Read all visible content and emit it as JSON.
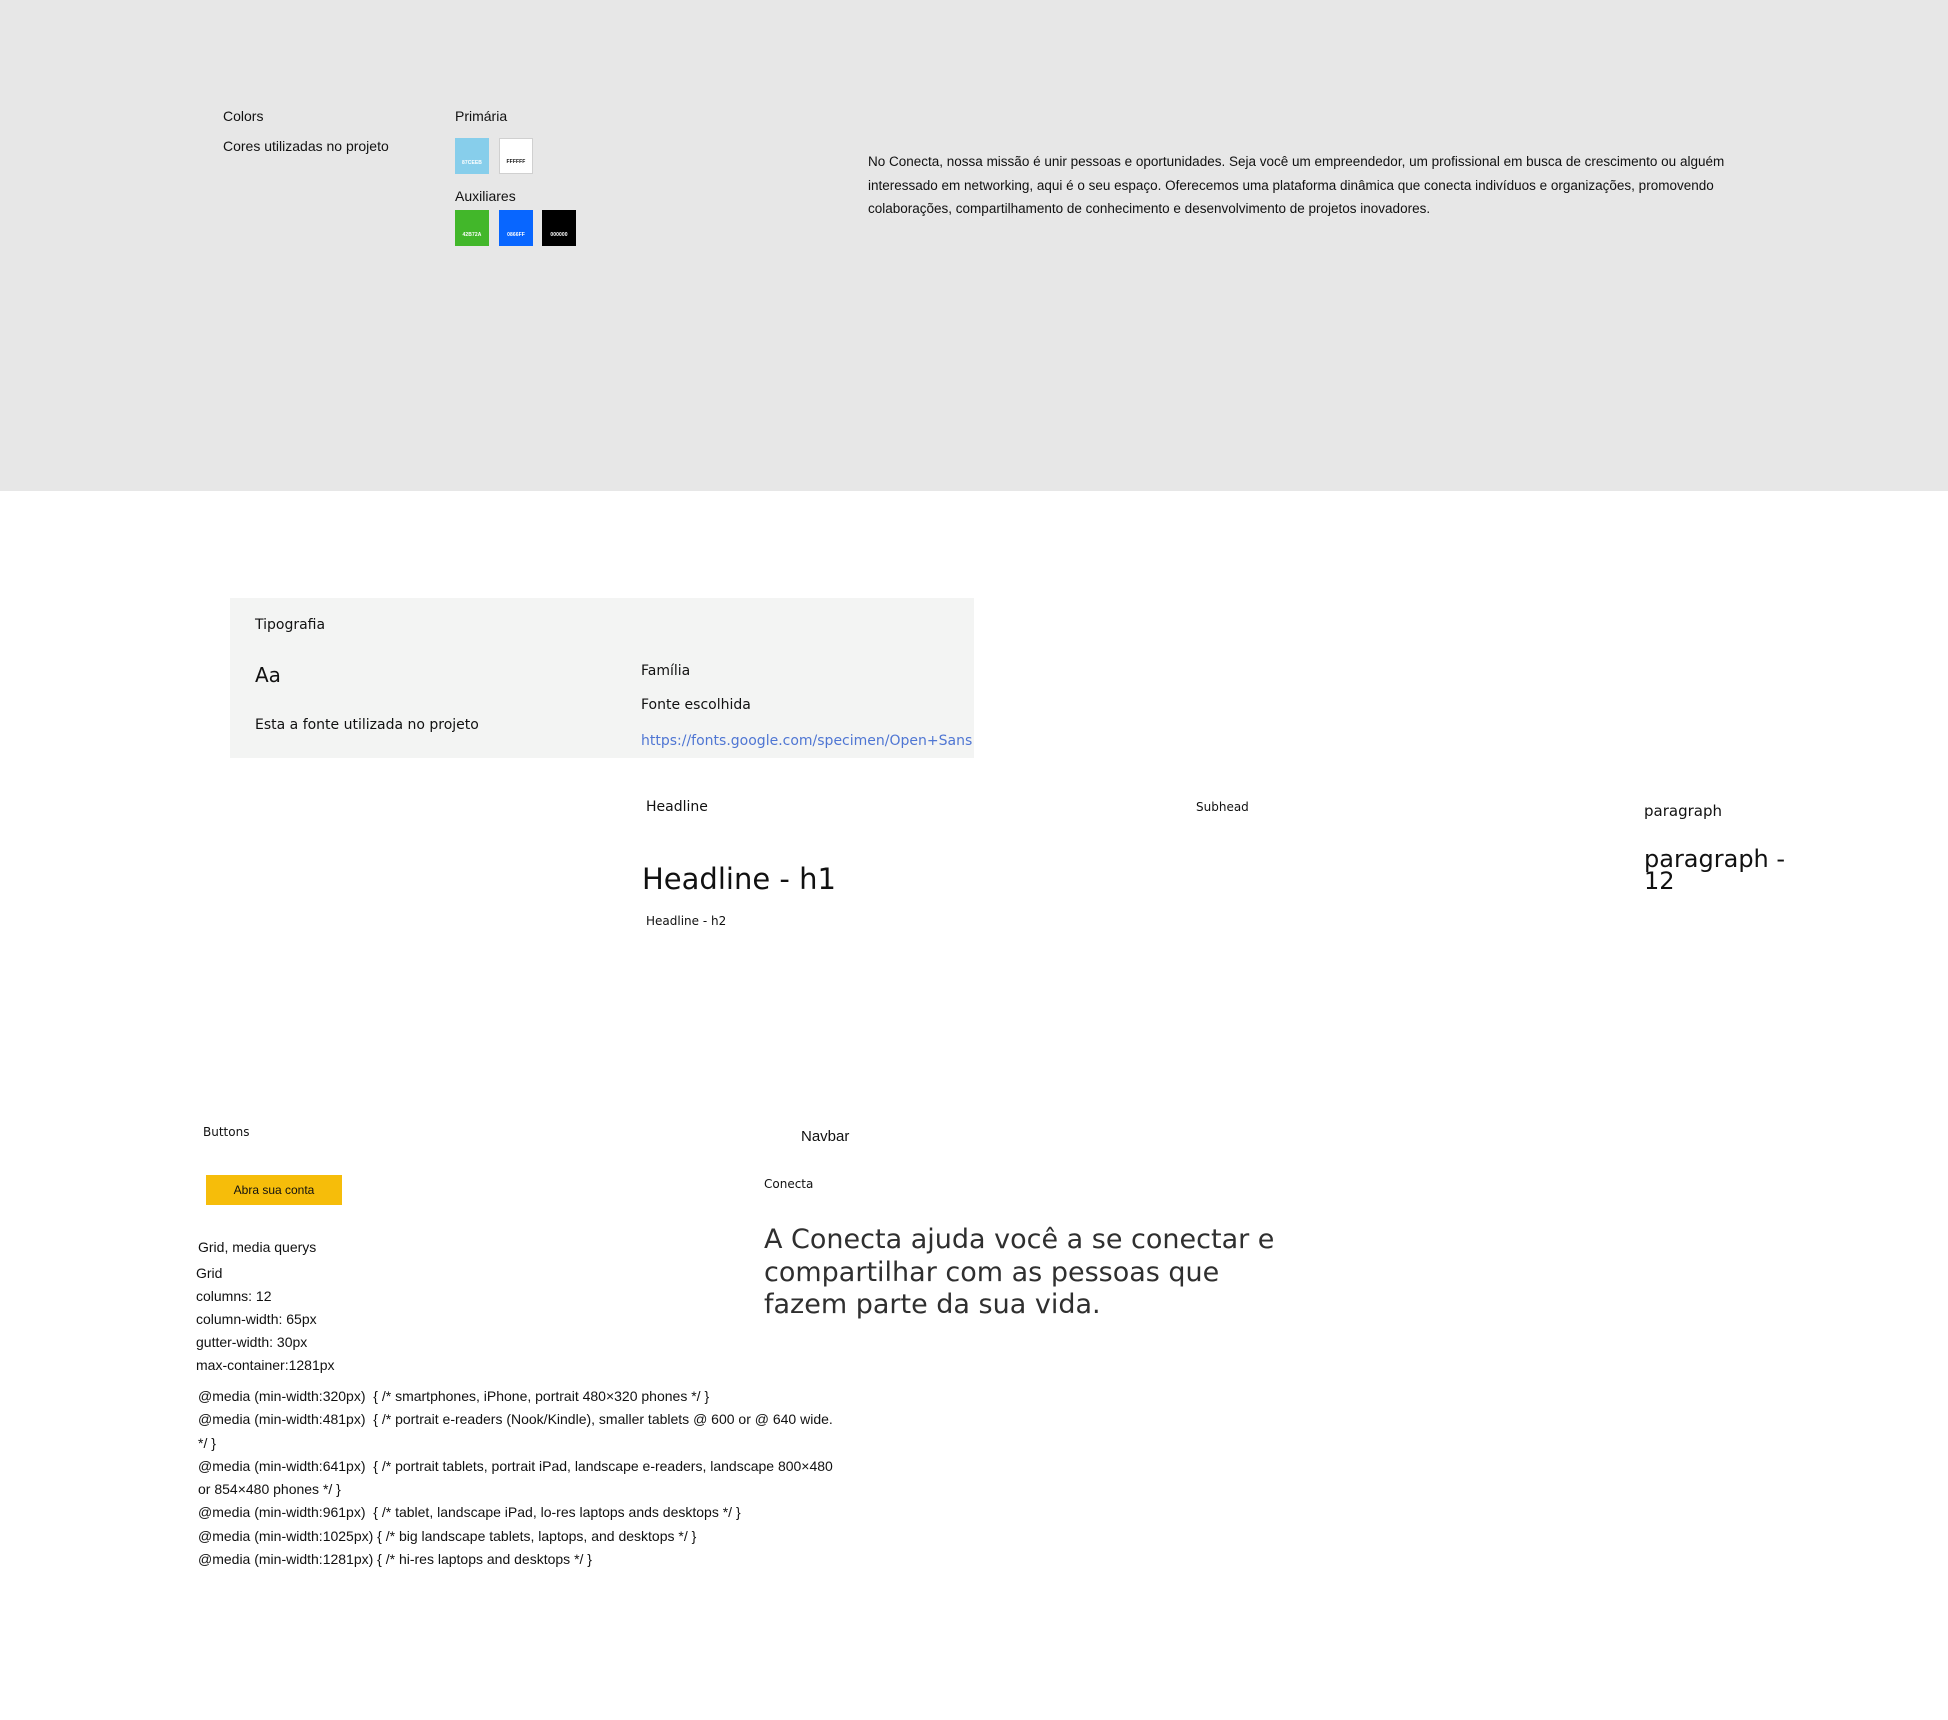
{
  "colors": {
    "title": "Colors",
    "subtitle": "Cores utilizadas no projeto",
    "primary_label": "Primária",
    "auxiliary_label": "Auxiliares",
    "primary": [
      {
        "hex": "#87CEEB",
        "label": "87CEEB",
        "text_color": "#ffffff"
      },
      {
        "hex": "#FFFFFF",
        "label": "FFFFFF",
        "text_color": "#111111"
      }
    ],
    "auxiliary": [
      {
        "hex": "#42B72A",
        "label": "42B72A",
        "text_color": "#ffffff"
      },
      {
        "hex": "#0866FF",
        "label": "0866FF",
        "text_color": "#ffffff"
      },
      {
        "hex": "#000000",
        "label": "000000",
        "text_color": "#ffffff"
      }
    ]
  },
  "about": {
    "text": "No Conecta, nossa missão é unir pessoas e oportunidades. Seja você um empreendedor, um profissional em busca de crescimento ou alguém interessado em networking, aqui é o seu espaço. Oferecemos uma plataforma dinâmica que conecta indivíduos e organizações, promovendo colaborações, compartilhamento de conhecimento e desenvolvimento de projetos inovadores."
  },
  "typography": {
    "title": "Tipografia",
    "sample": "Aa",
    "description": "Esta  a fonte utilizada no projeto",
    "family_label": "Família",
    "chosen_label": "Fonte escolhida",
    "link": "https://fonts.google.com/specimen/Open+Sans",
    "headline_label": "Headline",
    "h1_sample": "Headline - h1",
    "h2_sample": "Headline - h2",
    "subhead_label": "Subhead",
    "paragraph_label": "paragraph",
    "paragraph_sample": "paragraph - 12"
  },
  "buttons": {
    "title": "Buttons",
    "primary_label": "Abra sua conta",
    "primary_color": "#F6BD0A"
  },
  "navbar": {
    "title": "Navbar",
    "brand": "Conecta",
    "hero": "A Conecta ajuda você a se conectar e compartilhar com as pessoas que fazem parte da sua vida."
  },
  "grid": {
    "title": "Grid, media querys",
    "subtitle": "Grid",
    "columns": "columns: 12",
    "column_width": "column-width: 65px",
    "gutter_width": "gutter-width: 30px",
    "max_container": "max-container:1281px",
    "media_queries": [
      "@media (min-width:320px)  { /* smartphones, iPhone, portrait 480×320 phones */ }",
      "@media (min-width:481px)  { /* portrait e-readers (Nook/Kindle), smaller tablets @ 600 or @ 640 wide. */ }",
      "@media (min-width:641px)  { /* portrait tablets, portrait iPad, landscape e-readers, landscape 800×480 or 854×480 phones */ }",
      "@media (min-width:961px)  { /* tablet, landscape iPad, lo-res laptops ands desktops */ }",
      "@media (min-width:1025px) { /* big landscape tablets, laptops, and desktops */ }",
      "@media (min-width:1281px) { /* hi-res laptops and desktops */ }"
    ]
  }
}
